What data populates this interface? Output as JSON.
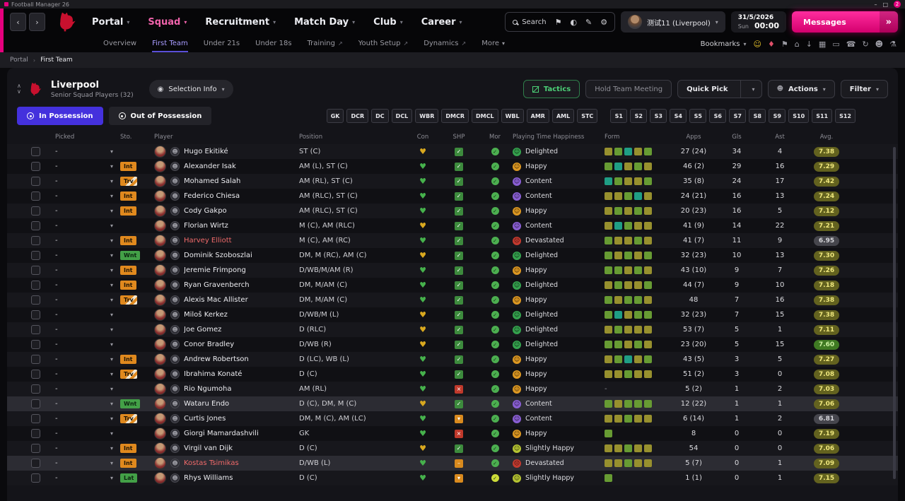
{
  "window": {
    "title": "Football Manager 26",
    "notification_count": "2"
  },
  "topnav": {
    "menus": [
      {
        "label": "Portal"
      },
      {
        "label": "Squad",
        "active": true
      },
      {
        "label": "Recruitment"
      },
      {
        "label": "Match Day"
      },
      {
        "label": "Club"
      },
      {
        "label": "Career"
      }
    ],
    "search_label": "Search",
    "toolbar_icons": [
      {
        "name": "bookmark-icon",
        "glyph": "⚑"
      },
      {
        "name": "display-mode-icon",
        "glyph": "◐"
      },
      {
        "name": "edit-icon",
        "glyph": "✎"
      },
      {
        "name": "settings-icon",
        "glyph": "⚙"
      }
    ],
    "profile_name": "测试11 (Liverpool)",
    "date": "31/5/2026",
    "day": "Sun",
    "time": "00:00",
    "messages_label": "Messages"
  },
  "subnav": {
    "items": [
      {
        "label": "Overview"
      },
      {
        "label": "First Team",
        "active": true
      },
      {
        "label": "Under 21s"
      },
      {
        "label": "Under 18s"
      },
      {
        "label": "Training",
        "external": true
      },
      {
        "label": "Youth Setup",
        "external": true
      },
      {
        "label": "Dynamics",
        "external": true
      },
      {
        "label": "More",
        "chevron": true
      }
    ],
    "bookmarks_label": "Bookmarks",
    "icons": [
      {
        "name": "manager-profile-icon",
        "glyph": "☺",
        "color": "#e8c32a"
      },
      {
        "name": "kit-icon",
        "glyph": "♦",
        "color": "#e0506a"
      },
      {
        "name": "trophy-icon",
        "glyph": "⚑",
        "color": "#9a9aa2"
      },
      {
        "name": "home-icon",
        "glyph": "⌂",
        "color": "#9a9aa2"
      },
      {
        "name": "download-icon",
        "glyph": "↓",
        "color": "#9a9aa2"
      },
      {
        "name": "calendar-icon",
        "glyph": "▦",
        "color": "#9a9aa2"
      },
      {
        "name": "monitor-icon",
        "glyph": "▭",
        "color": "#9a9aa2"
      },
      {
        "name": "phone-icon",
        "glyph": "☎",
        "color": "#9a9aa2"
      },
      {
        "name": "sync-icon",
        "glyph": "↻",
        "color": "#9a9aa2"
      },
      {
        "name": "social-icon",
        "glyph": "☻",
        "color": "#9a9aa2"
      },
      {
        "name": "lab-icon",
        "glyph": "⚗",
        "color": "#9a9aa2"
      }
    ]
  },
  "breadcrumb": {
    "items": [
      "Portal",
      "First Team"
    ]
  },
  "squad_header": {
    "club": "Liverpool",
    "subtitle": "Senior Squad Players (32)",
    "selection_info": "Selection Info",
    "buttons": {
      "tactics": "Tactics",
      "hold_team_meeting": "Hold Team Meeting",
      "quick_pick": "Quick Pick",
      "actions": "Actions",
      "filter": "Filter"
    }
  },
  "possession_tabs": {
    "in_label": "In Possession",
    "out_label": "Out of Possession"
  },
  "position_filters": {
    "group1": [
      "GK",
      "DCR",
      "DC",
      "DCL",
      "WBR",
      "DMCR",
      "DMCL",
      "WBL",
      "AMR",
      "AML",
      "STC"
    ],
    "group2": [
      "S1",
      "S2",
      "S3",
      "S4",
      "S5",
      "S6",
      "S7",
      "S8",
      "S9",
      "S10",
      "S11",
      "S12"
    ]
  },
  "table": {
    "picked_value": "-",
    "headers": {
      "picked": "Picked",
      "sto": "Sto.",
      "player": "Player",
      "position": "Position",
      "con": "Con",
      "shp": "SHP",
      "mor": "Mor",
      "happiness": "Playing Time Happiness",
      "form": "Form",
      "apps": "Apps",
      "gls": "Gls",
      "ast": "Ast",
      "avg": "Avg."
    },
    "rows": [
      {
        "status": "",
        "status_type": "",
        "name": "Hugo Ekitiké",
        "listed": false,
        "position": "ST (C)",
        "con": "yellow",
        "shp": "check",
        "mor": "green",
        "happiness": "Delighted",
        "mood": "delighted",
        "form": [
          "oli",
          "grn",
          "tea",
          "oli",
          "grn"
        ],
        "apps": "27 (24)",
        "gls": "34",
        "ast": "4",
        "avg": "7.38",
        "avg_tone": "olive",
        "highlight": false
      },
      {
        "status": "Int",
        "status_type": "orange",
        "name": "Alexander Isak",
        "listed": false,
        "position": "AM (L), ST (C)",
        "con": "green",
        "shp": "check",
        "mor": "green",
        "happiness": "Happy",
        "mood": "happy",
        "form": [
          "grn",
          "tea",
          "oli",
          "grn",
          "oli"
        ],
        "apps": "46 (2)",
        "gls": "29",
        "ast": "16",
        "avg": "7.29",
        "avg_tone": "olive",
        "highlight": false
      },
      {
        "status": "Trv",
        "status_type": "striped",
        "name": "Mohamed Salah",
        "listed": false,
        "position": "AM (RL), ST (C)",
        "con": "green",
        "shp": "check",
        "mor": "green",
        "happiness": "Content",
        "mood": "content",
        "form": [
          "tea",
          "grn",
          "oli",
          "oli",
          "grn"
        ],
        "apps": "35 (8)",
        "gls": "24",
        "ast": "17",
        "avg": "7.42",
        "avg_tone": "olive",
        "highlight": false
      },
      {
        "status": "Int",
        "status_type": "orange",
        "name": "Federico Chiesa",
        "listed": false,
        "position": "AM (RLC), ST (C)",
        "con": "green",
        "shp": "check",
        "mor": "green",
        "happiness": "Content",
        "mood": "content",
        "form": [
          "oli",
          "oli",
          "grn",
          "tea",
          "oli"
        ],
        "apps": "24 (21)",
        "gls": "16",
        "ast": "13",
        "avg": "7.24",
        "avg_tone": "olive",
        "highlight": false
      },
      {
        "status": "Int",
        "status_type": "orange",
        "name": "Cody Gakpo",
        "listed": false,
        "position": "AM (RLC), ST (C)",
        "con": "green",
        "shp": "check",
        "mor": "green",
        "happiness": "Happy",
        "mood": "happy",
        "form": [
          "oli",
          "grn",
          "oli",
          "grn",
          "oli"
        ],
        "apps": "20 (23)",
        "gls": "16",
        "ast": "5",
        "avg": "7.12",
        "avg_tone": "olive",
        "highlight": false
      },
      {
        "status": "",
        "status_type": "",
        "name": "Florian Wirtz",
        "listed": false,
        "position": "M (C), AM (RLC)",
        "con": "yellow",
        "shp": "check",
        "mor": "green",
        "happiness": "Content",
        "mood": "content",
        "form": [
          "oli",
          "tea",
          "grn",
          "oli",
          "oli"
        ],
        "apps": "41 (9)",
        "gls": "14",
        "ast": "22",
        "avg": "7.21",
        "avg_tone": "olive",
        "highlight": false
      },
      {
        "status": "Int",
        "status_type": "orange",
        "name": "Harvey Elliott",
        "listed": true,
        "position": "M (C), AM (RC)",
        "con": "green",
        "shp": "check",
        "mor": "green",
        "happiness": "Devastated",
        "mood": "devastated",
        "form": [
          "grn",
          "oli",
          "oli",
          "grn",
          "oli"
        ],
        "apps": "41 (7)",
        "gls": "11",
        "ast": "9",
        "avg": "6.95",
        "avg_tone": "gray",
        "highlight": false
      },
      {
        "status": "Wnt",
        "status_type": "green",
        "name": "Dominik Szoboszlai",
        "listed": false,
        "position": "DM, M (RC), AM (C)",
        "con": "yellow",
        "shp": "check",
        "mor": "green",
        "happiness": "Delighted",
        "mood": "delighted",
        "form": [
          "grn",
          "oli",
          "grn",
          "oli",
          "grn"
        ],
        "apps": "32 (23)",
        "gls": "10",
        "ast": "13",
        "avg": "7.30",
        "avg_tone": "olive",
        "highlight": false
      },
      {
        "status": "Int",
        "status_type": "orange",
        "name": "Jeremie Frimpong",
        "listed": false,
        "position": "D/WB/M/AM (R)",
        "con": "green",
        "shp": "check",
        "mor": "green",
        "happiness": "Happy",
        "mood": "happy",
        "form": [
          "grn",
          "grn",
          "oli",
          "grn",
          "oli"
        ],
        "apps": "43 (10)",
        "gls": "9",
        "ast": "7",
        "avg": "7.26",
        "avg_tone": "olive",
        "highlight": false
      },
      {
        "status": "Int",
        "status_type": "orange",
        "name": "Ryan Gravenberch",
        "listed": false,
        "position": "DM, M/AM (C)",
        "con": "green",
        "shp": "check",
        "mor": "green",
        "happiness": "Delighted",
        "mood": "delighted",
        "form": [
          "oli",
          "grn",
          "oli",
          "oli",
          "grn"
        ],
        "apps": "44 (7)",
        "gls": "9",
        "ast": "10",
        "avg": "7.18",
        "avg_tone": "olive",
        "highlight": false
      },
      {
        "status": "Trv",
        "status_type": "striped",
        "name": "Alexis Mac Allister",
        "listed": false,
        "position": "DM, M/AM (C)",
        "con": "green",
        "shp": "check",
        "mor": "green",
        "happiness": "Happy",
        "mood": "happy",
        "form": [
          "grn",
          "oli",
          "grn",
          "grn",
          "oli"
        ],
        "apps": "48",
        "gls": "7",
        "ast": "16",
        "avg": "7.38",
        "avg_tone": "olive",
        "highlight": false
      },
      {
        "status": "",
        "status_type": "",
        "name": "Miloš Kerkez",
        "listed": false,
        "position": "D/WB/M (L)",
        "con": "yellow",
        "shp": "check",
        "mor": "green",
        "happiness": "Delighted",
        "mood": "delighted",
        "form": [
          "grn",
          "tea",
          "oli",
          "grn",
          "grn"
        ],
        "apps": "32 (23)",
        "gls": "7",
        "ast": "15",
        "avg": "7.38",
        "avg_tone": "olive",
        "highlight": false
      },
      {
        "status": "",
        "status_type": "",
        "name": "Joe Gomez",
        "listed": false,
        "position": "D (RLC)",
        "con": "yellow",
        "shp": "check",
        "mor": "green",
        "happiness": "Delighted",
        "mood": "delighted",
        "form": [
          "oli",
          "grn",
          "oli",
          "oli",
          "oli"
        ],
        "apps": "53 (7)",
        "gls": "5",
        "ast": "1",
        "avg": "7.11",
        "avg_tone": "olive",
        "highlight": false
      },
      {
        "status": "",
        "status_type": "",
        "name": "Conor Bradley",
        "listed": false,
        "position": "D/WB (R)",
        "con": "yellow",
        "shp": "check",
        "mor": "green",
        "happiness": "Delighted",
        "mood": "delighted",
        "form": [
          "grn",
          "grn",
          "oli",
          "grn",
          "oli"
        ],
        "apps": "23 (20)",
        "gls": "5",
        "ast": "15",
        "avg": "7.60",
        "avg_tone": "green",
        "highlight": false
      },
      {
        "status": "Int",
        "status_type": "orange",
        "name": "Andrew Robertson",
        "listed": false,
        "position": "D (LC), WB (L)",
        "con": "green",
        "shp": "check",
        "mor": "green",
        "happiness": "Happy",
        "mood": "happy",
        "form": [
          "oli",
          "grn",
          "tea",
          "oli",
          "grn"
        ],
        "apps": "43 (5)",
        "gls": "3",
        "ast": "5",
        "avg": "7.27",
        "avg_tone": "olive",
        "highlight": false
      },
      {
        "status": "Trv",
        "status_type": "striped",
        "name": "Ibrahima Konaté",
        "listed": false,
        "position": "D (C)",
        "con": "green",
        "shp": "check",
        "mor": "green",
        "happiness": "Happy",
        "mood": "happy",
        "form": [
          "oli",
          "oli",
          "grn",
          "oli",
          "oli"
        ],
        "apps": "51 (2)",
        "gls": "3",
        "ast": "0",
        "avg": "7.08",
        "avg_tone": "olive",
        "highlight": false
      },
      {
        "status": "",
        "status_type": "",
        "name": "Rio Ngumoha",
        "listed": false,
        "position": "AM (RL)",
        "con": "green",
        "shp": "cross",
        "mor": "green",
        "happiness": "Happy",
        "mood": "happy",
        "form": [],
        "apps": "5 (2)",
        "gls": "1",
        "ast": "2",
        "avg": "7.03",
        "avg_tone": "olive",
        "highlight": false
      },
      {
        "status": "Wnt",
        "status_type": "green",
        "name": "Wataru Endo",
        "listed": false,
        "position": "D (C), DM, M (C)",
        "con": "yellow",
        "shp": "check",
        "mor": "green",
        "happiness": "Content",
        "mood": "content",
        "form": [
          "grn",
          "oli",
          "grn",
          "grn",
          "grn"
        ],
        "apps": "12 (22)",
        "gls": "1",
        "ast": "1",
        "avg": "7.06",
        "avg_tone": "olive",
        "highlight": true
      },
      {
        "status": "Trv",
        "status_type": "striped",
        "name": "Curtis Jones",
        "listed": false,
        "position": "DM, M (C), AM (LC)",
        "con": "green",
        "shp": "down",
        "mor": "green",
        "happiness": "Content",
        "mood": "content",
        "form": [
          "oli",
          "oli",
          "grn",
          "oli",
          "oli"
        ],
        "apps": "6 (14)",
        "gls": "1",
        "ast": "2",
        "avg": "6.81",
        "avg_tone": "gray",
        "highlight": false
      },
      {
        "status": "",
        "status_type": "",
        "name": "Giorgi Mamardashvili",
        "listed": false,
        "position": "GK",
        "con": "green",
        "shp": "cross",
        "mor": "green",
        "happiness": "Happy",
        "mood": "happy",
        "form": [
          "grn"
        ],
        "apps": "8",
        "gls": "0",
        "ast": "0",
        "avg": "7.19",
        "avg_tone": "olive",
        "highlight": false
      },
      {
        "status": "Int",
        "status_type": "orange",
        "name": "Virgil van Dijk",
        "listed": false,
        "position": "D (C)",
        "con": "yellow",
        "shp": "check",
        "mor": "green",
        "happiness": "Slightly Happy",
        "mood": "slightly",
        "form": [
          "oli",
          "oli",
          "grn",
          "oli",
          "oli"
        ],
        "apps": "54",
        "gls": "0",
        "ast": "0",
        "avg": "7.06",
        "avg_tone": "olive",
        "highlight": false
      },
      {
        "status": "Int",
        "status_type": "orange",
        "name": "Kostas Tsimikas",
        "listed": true,
        "position": "D/WB (L)",
        "con": "green",
        "shp": "dash",
        "mor": "green",
        "happiness": "Devastated",
        "mood": "devastated",
        "form": [
          "oli",
          "oli",
          "grn",
          "oli",
          "oli"
        ],
        "apps": "5 (7)",
        "gls": "0",
        "ast": "1",
        "avg": "7.09",
        "avg_tone": "olive",
        "highlight": true
      },
      {
        "status": "Lat",
        "status_type": "green",
        "name": "Rhys Williams",
        "listed": false,
        "position": "D (C)",
        "con": "green",
        "shp": "down",
        "mor": "yellow",
        "happiness": "Slightly Happy",
        "mood": "slightly",
        "form": [
          "grn"
        ],
        "apps": "1 (1)",
        "gls": "0",
        "ast": "1",
        "avg": "7.15",
        "avg_tone": "olive",
        "highlight": false
      }
    ]
  },
  "colors": {
    "accent_pink": "#e6007e",
    "active_menu": "#f063ab",
    "subnav_active": "#a89cff",
    "in_possession": "#4431dd",
    "tactics_green": "#4cd077",
    "con": {
      "green": "#46b24c",
      "yellow": "#d9a81f"
    },
    "shp": {
      "check": "#3d8b3d",
      "cross": "#c0392b",
      "down": "#d98a1e",
      "dash": "#d98a1e"
    },
    "mood": {
      "delighted": "#35a24e",
      "happy": "#dd9822",
      "content": "#8a5fd4",
      "devastated": "#c43a2f",
      "slightly": "#b5c332"
    },
    "form": {
      "grn": "#679b33",
      "tea": "#1f9e85",
      "oli": "#97902e"
    },
    "avg": {
      "olive_bg": "#63621f",
      "olive_fg": "#eee67c",
      "green_bg": "#3f7a23",
      "green_fg": "#c9efa0",
      "gray_bg": "#46464d",
      "gray_fg": "#d6d6da"
    }
  }
}
